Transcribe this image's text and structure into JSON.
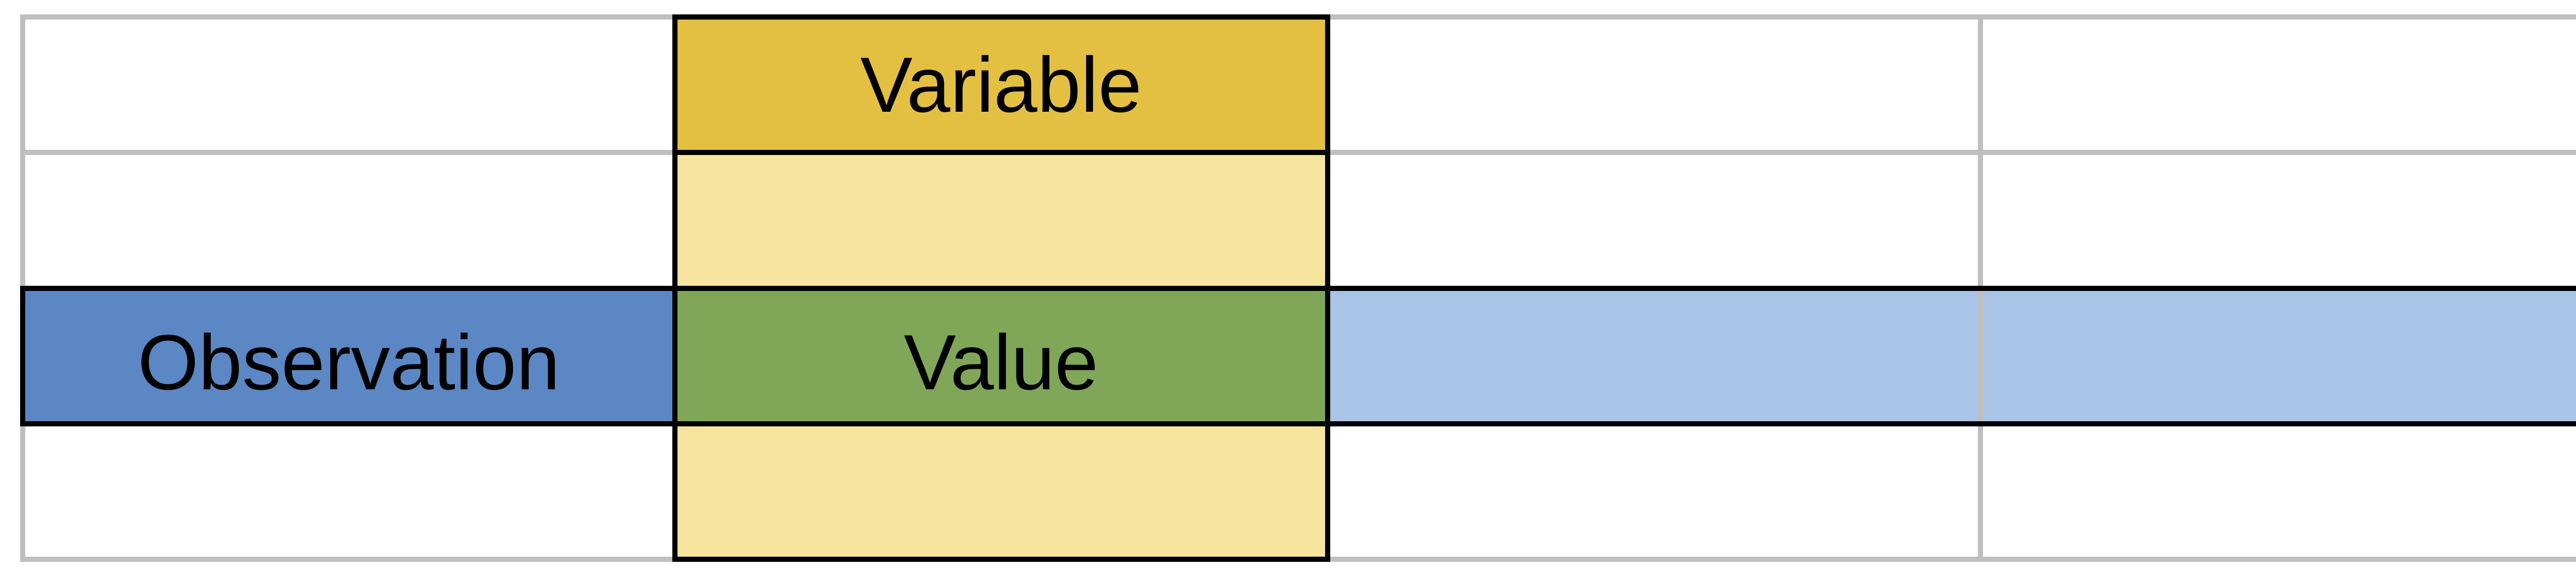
{
  "diagram": {
    "grid": {
      "rows": 4,
      "columns": 4
    },
    "labels": {
      "variable": "Variable",
      "observation": "Observation",
      "value": "Value"
    },
    "highlights": {
      "variable_column": 2,
      "observation_row": 2,
      "value_cell": [
        2,
        2
      ]
    },
    "colors": {
      "background": "#ffffff",
      "grid_line": "#bfbfbf",
      "outline": "#000000",
      "variable_header": "#e4c042",
      "variable_column": "#f7e49e",
      "observation_header": "#5b87c5",
      "observation_row": "#a9c4e7",
      "value_cell": "#80a757"
    }
  }
}
